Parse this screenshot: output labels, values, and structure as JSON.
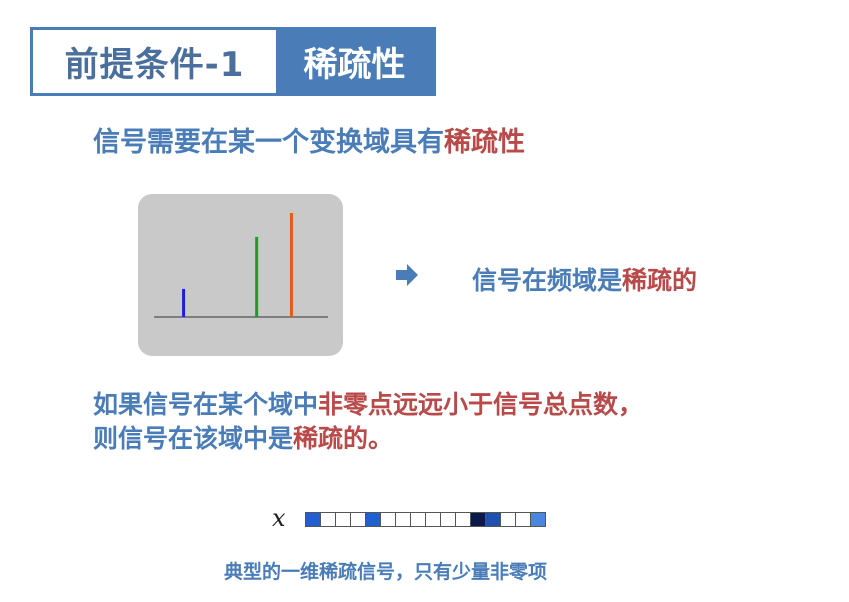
{
  "title": {
    "left": "前提条件-1",
    "right": "稀疏性"
  },
  "heading": {
    "prefix": "信号需要在某一个变换域具有",
    "highlight": "稀疏性"
  },
  "figure": {
    "spikes": [
      {
        "pos": 0.17,
        "height": 0.27,
        "color": "#1a22d6"
      },
      {
        "pos": 0.59,
        "height": 0.77,
        "color": "#1f9a2a"
      },
      {
        "pos": 0.79,
        "height": 1.0,
        "color": "#e35d1a"
      }
    ]
  },
  "freq_text": {
    "prefix": "信号在频域是",
    "highlight": "稀疏的"
  },
  "paragraph": {
    "line1_prefix": "如果信号在某个域中",
    "line1_highlight": "非零点远远小于信号总点数，",
    "line2_prefix": "则信号在该域中是",
    "line2_highlight": "稀疏的。"
  },
  "vector": {
    "label": "x",
    "cells": [
      "#1f5fd0",
      "#ffffff",
      "#ffffff",
      "#ffffff",
      "#1f5fd0",
      "#ffffff",
      "#ffffff",
      "#ffffff",
      "#ffffff",
      "#ffffff",
      "#ffffff",
      "#0a1a4a",
      "#1f4fb0",
      "#ffffff",
      "#ffffff",
      "#4a86e0"
    ]
  },
  "caption": "典型的一维稀疏信号，只有少量非零项",
  "colors": {
    "accent": "#4a7db8",
    "highlight": "#b84a4a"
  }
}
